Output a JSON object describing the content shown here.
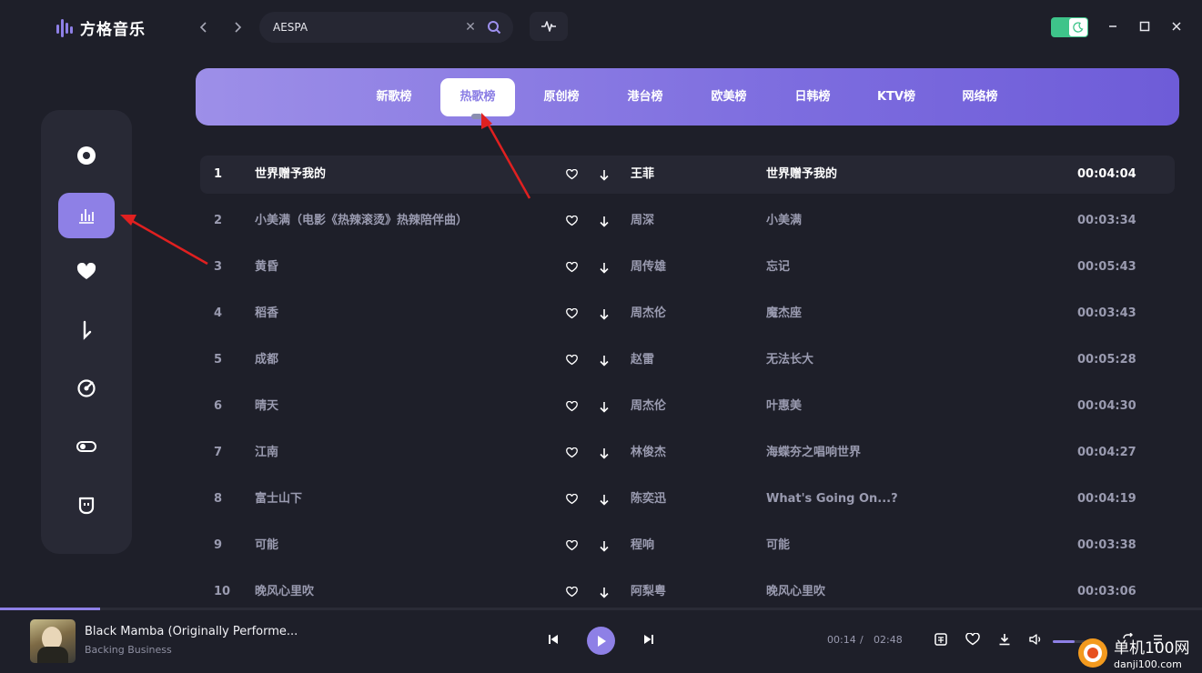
{
  "app": {
    "name": "方格音乐"
  },
  "search": {
    "value": "AESPA"
  },
  "tabs": [
    {
      "label": "新歌榜",
      "active": false
    },
    {
      "label": "热歌榜",
      "active": true
    },
    {
      "label": "原创榜",
      "active": false
    },
    {
      "label": "港台榜",
      "active": false
    },
    {
      "label": "欧美榜",
      "active": false
    },
    {
      "label": "日韩榜",
      "active": false
    },
    {
      "label": "KTV榜",
      "active": false
    },
    {
      "label": "网络榜",
      "active": false
    }
  ],
  "sidebar": {
    "items": [
      {
        "icon": "disc-icon",
        "active": false
      },
      {
        "icon": "chart-bars-icon",
        "active": true
      },
      {
        "icon": "heart-icon",
        "active": false
      },
      {
        "icon": "download-icon",
        "active": false
      },
      {
        "icon": "radar-icon",
        "active": false
      },
      {
        "icon": "toggle-icon",
        "active": false
      },
      {
        "icon": "chat-icon",
        "active": false
      }
    ]
  },
  "songs": [
    {
      "num": "1",
      "title": "世界赠予我的",
      "artist": "王菲",
      "album": "世界赠予我的",
      "duration": "00:04:04"
    },
    {
      "num": "2",
      "title": "小美满（电影《热辣滚烫》热辣陪伴曲）",
      "artist": "周深",
      "album": "小美满",
      "duration": "00:03:34"
    },
    {
      "num": "3",
      "title": "黄昏",
      "artist": "周传雄",
      "album": "忘记",
      "duration": "00:05:43"
    },
    {
      "num": "4",
      "title": "稻香",
      "artist": "周杰伦",
      "album": "魔杰座",
      "duration": "00:03:43"
    },
    {
      "num": "5",
      "title": "成都",
      "artist": "赵雷",
      "album": "无法长大",
      "duration": "00:05:28"
    },
    {
      "num": "6",
      "title": "晴天",
      "artist": "周杰伦",
      "album": "叶惠美",
      "duration": "00:04:30"
    },
    {
      "num": "7",
      "title": "江南",
      "artist": "林俊杰",
      "album": "海蝶夯之唱响世界",
      "duration": "00:04:27"
    },
    {
      "num": "8",
      "title": "富士山下",
      "artist": "陈奕迅",
      "album": "What's Going On...?",
      "duration": "00:04:19"
    },
    {
      "num": "9",
      "title": "可能",
      "artist": "程响",
      "album": "可能",
      "duration": "00:03:38"
    },
    {
      "num": "10",
      "title": "晚风心里吹",
      "artist": "阿梨粤",
      "album": "晚风心里吹",
      "duration": "00:03:06"
    }
  ],
  "player": {
    "title": "Black Mamba (Originally Performe...",
    "artist": "Backing Business",
    "current_time": "00:14",
    "separator": "/",
    "total_time": "02:48",
    "progress": 0.083,
    "volume": 0.6
  },
  "watermark": {
    "text": "单机100网",
    "url_text": "danji100.com"
  },
  "colors": {
    "accent": "#8e80e6",
    "background": "#1e1f29",
    "panel": "#282935",
    "toggle_green": "#3ec48a",
    "annotation_red": "#e02020"
  }
}
